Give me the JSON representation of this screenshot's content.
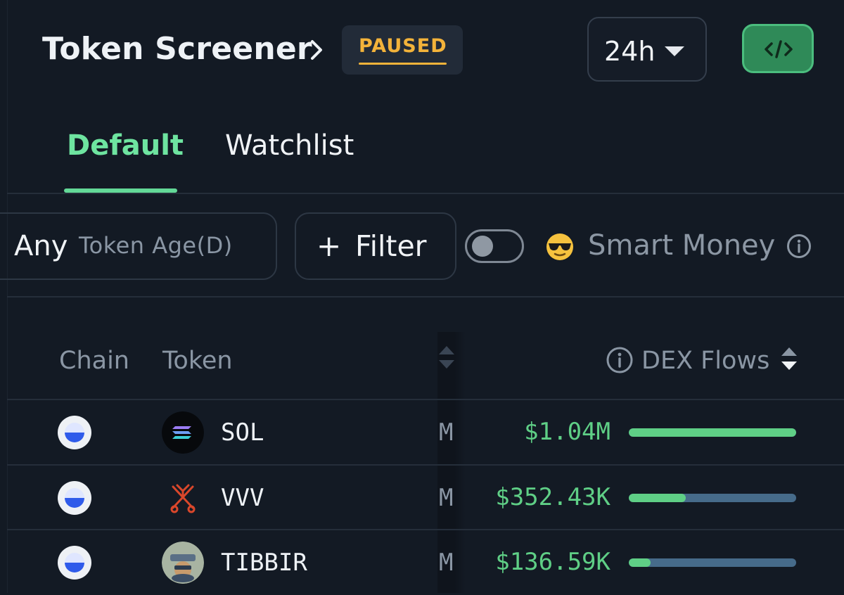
{
  "header": {
    "title": "Token Screener",
    "status_badge": "PAUSED",
    "time_range": "24h"
  },
  "tabs": [
    {
      "label": "Default",
      "active": true
    },
    {
      "label": "Watchlist",
      "active": false
    }
  ],
  "filters": {
    "token_age_value": "Any",
    "token_age_label": "Token Age(D)",
    "filter_plus": "+",
    "filter_label": "Filter",
    "smart_money_label": "Smart Money",
    "smart_money_enabled": false
  },
  "table": {
    "columns": {
      "chain": "Chain",
      "token": "Token",
      "dex_flows": "DEX Flows"
    },
    "rows": [
      {
        "symbol": "SOL",
        "mcol": "M",
        "dex_flows": "$1.04M",
        "flow_fraction": 1.0
      },
      {
        "symbol": "VVV",
        "mcol": "M",
        "dex_flows": "$352.43K",
        "flow_fraction": 0.34
      },
      {
        "symbol": "TIBBIR",
        "mcol": "M",
        "dex_flows": "$136.59K",
        "flow_fraction": 0.13
      }
    ]
  },
  "colors": {
    "accent_green": "#63d897",
    "paused_yellow": "#f3b33a",
    "flow_green": "#5fcf86",
    "bar_track": "#466b8a"
  },
  "icons": {
    "chevron": "chevron-right-icon",
    "time_range_caret": "caret-down-icon",
    "embed": "code-icon",
    "smart_money": "sunglasses-emoji-icon",
    "info": "info-icon",
    "sort": "sort-icon"
  }
}
